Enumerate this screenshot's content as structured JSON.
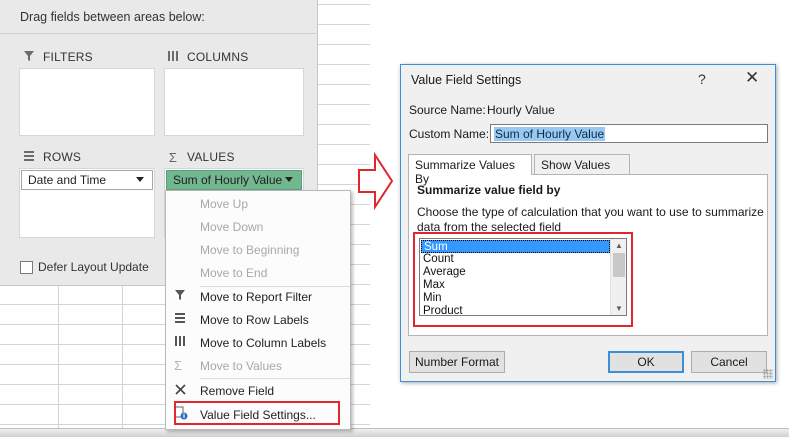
{
  "field_list": {
    "header": "Drag fields between areas below:",
    "filters_label": "FILTERS",
    "columns_label": "COLUMNS",
    "rows_label": "ROWS",
    "values_label": "VALUES",
    "row_field": "Date and Time",
    "value_field": "Sum of Hourly Value",
    "defer_label": "Defer Layout Update",
    "defer_checked": false
  },
  "context_menu": {
    "items": [
      {
        "label": "Move Up",
        "enabled": false,
        "icon": ""
      },
      {
        "label": "Move Down",
        "enabled": false,
        "icon": ""
      },
      {
        "label": "Move to Beginning",
        "enabled": false,
        "icon": ""
      },
      {
        "label": "Move to End",
        "enabled": false,
        "icon": ""
      },
      {
        "label": "Move to Report Filter",
        "enabled": true,
        "icon": "filter-icon"
      },
      {
        "label": "Move to Row Labels",
        "enabled": true,
        "icon": "rows-icon"
      },
      {
        "label": "Move to Column Labels",
        "enabled": true,
        "icon": "columns-icon"
      },
      {
        "label": "Move to Values",
        "enabled": false,
        "icon": "sigma-icon"
      },
      {
        "label": "Remove Field",
        "enabled": true,
        "icon": "remove-x-icon"
      },
      {
        "label": "Value Field Settings...",
        "enabled": true,
        "icon": "field-settings-icon"
      }
    ]
  },
  "dialog": {
    "title": "Value Field Settings",
    "help": "?",
    "close": "✕",
    "source_label": "Source Name:",
    "source_value": "Hourly Value",
    "custom_label": "Custom Name:",
    "custom_value": "Sum of Hourly Value",
    "tabs": [
      "Summarize Values By",
      "Show Values As"
    ],
    "section_title": "Summarize value field by",
    "description_line1": "Choose the type of calculation that you want to use to summarize",
    "description_line2": "data from the selected field",
    "options": [
      "Sum",
      "Count",
      "Average",
      "Max",
      "Min",
      "Product"
    ],
    "selected_option": "Sum",
    "number_format_button": "Number Format",
    "ok_button": "OK",
    "cancel_button": "Cancel"
  },
  "colors": {
    "highlight_red": "#e0272d",
    "value_chip_green": "#73b78f",
    "dialog_border_blue": "#3c8fd6"
  }
}
